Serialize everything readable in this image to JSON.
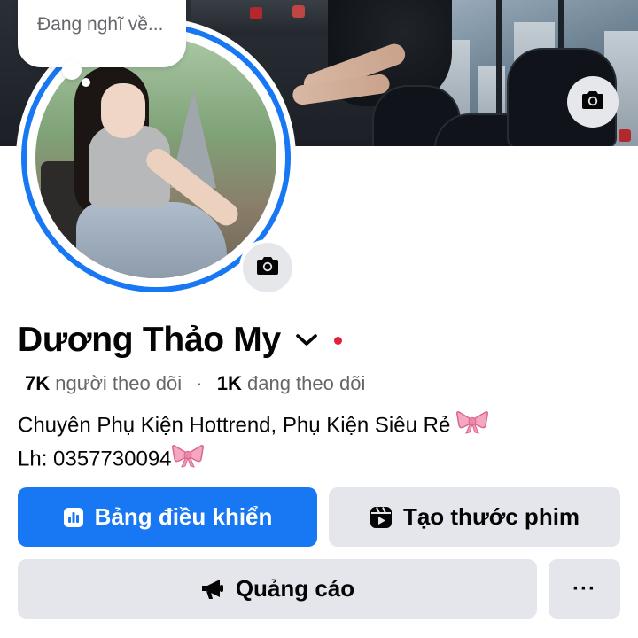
{
  "note": {
    "placeholder": "Đang nghĩ về..."
  },
  "profile": {
    "name": "Dương Thảo My",
    "followers_count": "7K",
    "followers_label": "người theo dõi",
    "separator": "·",
    "following_count": "1K",
    "following_label": "đang theo dõi",
    "bio_line1": "Chuyên Phụ Kiện Hottrend, Phụ Kiện Siêu Rẻ",
    "bio_line2": "Lh: 0357730094"
  },
  "actions": {
    "dashboard_label": "Bảng điều khiển",
    "create_reel_label": "Tạo thước phim",
    "ads_label": "Quảng cáo",
    "more_label": "···"
  },
  "icons": {
    "cover_camera": "camera-icon",
    "avatar_camera": "camera-icon",
    "name_dropdown": "chevron-down-icon",
    "dashboard": "bar-chart-icon",
    "reel": "reel-icon",
    "ads": "megaphone-icon",
    "bow": "ribbon-bow-emoji"
  },
  "colors": {
    "accent": "#1877f2",
    "secondary_button": "#e4e6eb",
    "status_dot": "#e41e3f",
    "muted_text": "#65676b"
  }
}
